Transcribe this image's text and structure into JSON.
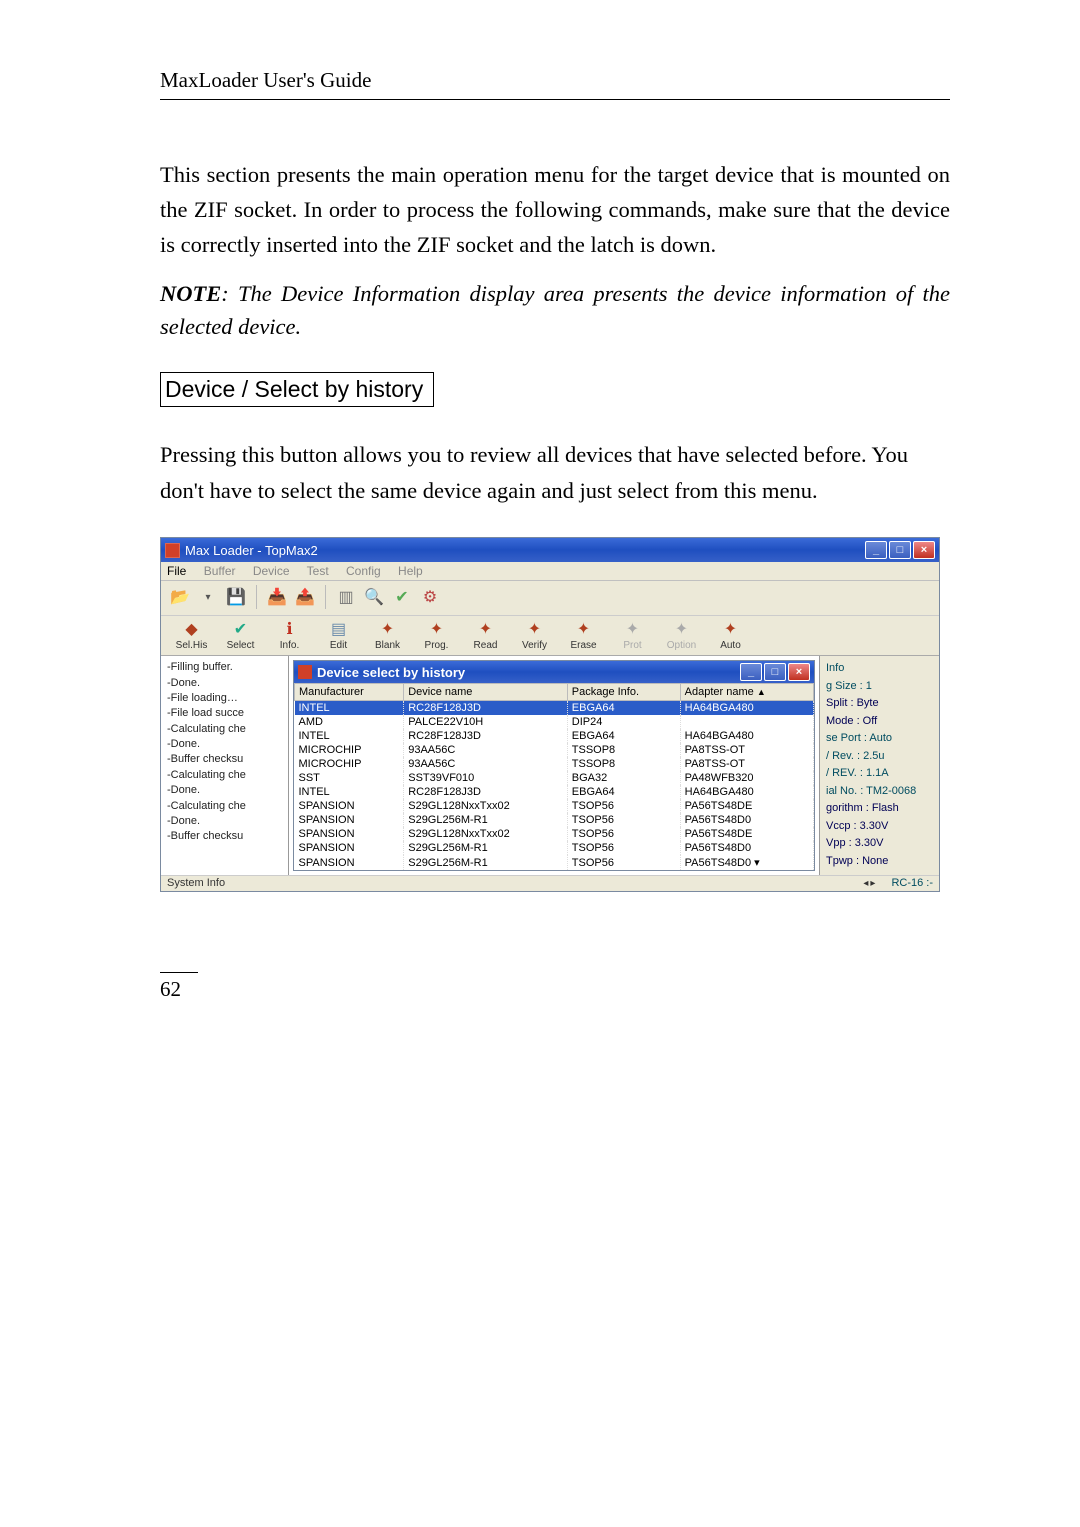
{
  "header": {
    "title": "MaxLoader User's Guide"
  },
  "paragraphs": {
    "p1": "This section presents the main operation menu for the target device that is mounted on the ZIF socket.  In order to process the following commands, make sure that the device is correctly inserted into the ZIF socket and the latch is down.",
    "note_label": "NOTE",
    "note_text": ": The Device Information display area presents the device information of the selected device.",
    "section_box": " Device / Select by history",
    "p2": "Pressing this button allows you to review all devices that have selected before. You don't have to select the same device again and just select from this menu."
  },
  "app_window": {
    "title": "Max Loader - TopMax2",
    "menus": [
      "File",
      "Buffer",
      "Device",
      "Test",
      "Config",
      "Help"
    ],
    "toolbar2": [
      {
        "label": "Sel.His",
        "active": true
      },
      {
        "label": "Select",
        "active": true
      },
      {
        "label": "Info.",
        "active": true
      },
      {
        "label": "Edit",
        "active": true
      },
      {
        "label": "Blank",
        "active": true
      },
      {
        "label": "Prog.",
        "active": true
      },
      {
        "label": "Read",
        "active": true
      },
      {
        "label": "Verify",
        "active": true
      },
      {
        "label": "Erase",
        "active": true
      },
      {
        "label": "Prot",
        "active": false
      },
      {
        "label": "Option",
        "active": false
      },
      {
        "label": "Auto",
        "active": true
      }
    ]
  },
  "log_lines": [
    "-Filling buffer.",
    "-Done.",
    "-File loading…",
    "-File load succe",
    "-Calculating che",
    "-Done.",
    "-Buffer checksu",
    "-Calculating che",
    "-Done.",
    "-Calculating che",
    "-Done.",
    "-Buffer checksu"
  ],
  "system_info_label": "System Info",
  "inner_window": {
    "title": "Device select by history",
    "columns": [
      "Manufacturer",
      "Device name",
      "Package Info.",
      "Adapter name"
    ],
    "rows": [
      {
        "c": [
          "INTEL",
          "RC28F128J3D",
          "EBGA64",
          "HA64BGA480"
        ],
        "sel": true
      },
      {
        "c": [
          "AMD",
          "PALCE22V10H",
          "DIP24",
          ""
        ]
      },
      {
        "c": [
          "INTEL",
          "RC28F128J3D",
          "EBGA64",
          "HA64BGA480"
        ]
      },
      {
        "c": [
          "MICROCHIP",
          "93AA56C",
          "TSSOP8",
          "PA8TSS-OT"
        ]
      },
      {
        "c": [
          "MICROCHIP",
          "93AA56C",
          "TSSOP8",
          "PA8TSS-OT"
        ]
      },
      {
        "c": [
          "SST",
          "SST39VF010",
          "BGA32",
          "PA48WFB320"
        ]
      },
      {
        "c": [
          "INTEL",
          "RC28F128J3D",
          "EBGA64",
          "HA64BGA480"
        ]
      },
      {
        "c": [
          "SPANSION",
          "S29GL128NxxTxx02",
          "TSOP56",
          "PA56TS48DE"
        ]
      },
      {
        "c": [
          "SPANSION",
          "S29GL256M-R1",
          "TSOP56",
          "PA56TS48D0"
        ]
      },
      {
        "c": [
          "SPANSION",
          "S29GL128NxxTxx02",
          "TSOP56",
          "PA56TS48DE"
        ]
      },
      {
        "c": [
          "SPANSION",
          "S29GL256M-R1",
          "TSOP56",
          "PA56TS48D0"
        ]
      },
      {
        "c": [
          "SPANSION",
          "S29GL256M-R1",
          "TSOP56",
          "PA56TS48D0"
        ]
      }
    ]
  },
  "info_panel": {
    "info_label": "Info",
    "size_label": "g Size : 1",
    "split": "Split : Byte",
    "mode": "Mode : Off",
    "port": "se Port : Auto",
    "rev": "/ Rev. : 2.5u",
    "rev2": "/ REV. : 1.1A",
    "ial": "ial No. : TM2-0068",
    "algo": "gorithm : Flash",
    "vccp": "Vccp : 3.30V",
    "vpp": "Vpp : 3.30V",
    "tpwp": "Tpwp : None",
    "rc": "RC-16 :-"
  },
  "page_number": "62"
}
